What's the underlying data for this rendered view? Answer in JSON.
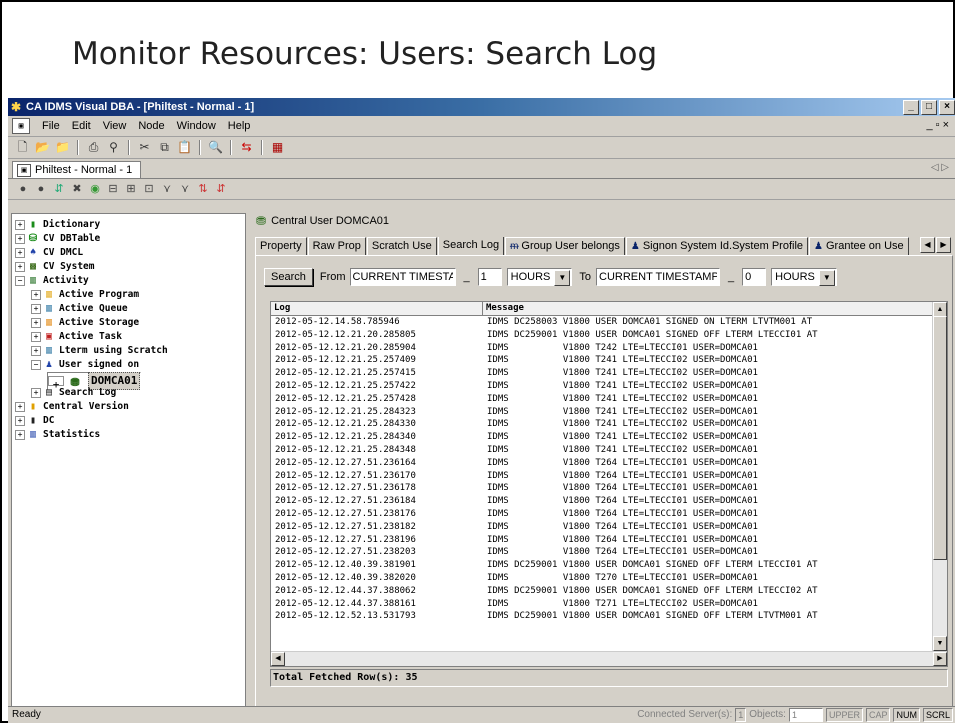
{
  "slide": {
    "title": "Monitor Resources: Users: Search Log"
  },
  "window": {
    "title": "CA IDMS Visual DBA - [Philtest - Normal - 1]",
    "controls": [
      "_",
      "□",
      "×"
    ]
  },
  "menu": {
    "items": [
      "File",
      "Edit",
      "View",
      "Node",
      "Window",
      "Help"
    ],
    "mdi_controls": "_ ▫ ×"
  },
  "doc_tab": {
    "label": "Philtest - Normal - 1",
    "arrows": "◁ ▷"
  },
  "tree": {
    "nodes": [
      {
        "label": "Dictionary",
        "icon": "dictionary-icon",
        "sign": "+"
      },
      {
        "label": "CV DBTable",
        "icon": "dbtable-icon",
        "sign": "+"
      },
      {
        "label": "CV DMCL",
        "icon": "dmcl-icon",
        "sign": "+"
      },
      {
        "label": "CV System",
        "icon": "system-icon",
        "sign": "+"
      },
      {
        "label": "Activity",
        "icon": "activity-icon",
        "sign": "−"
      },
      {
        "label": "Active Program",
        "icon": "program-icon",
        "sign": "+"
      },
      {
        "label": "Active Queue",
        "icon": "queue-icon",
        "sign": "+"
      },
      {
        "label": "Active Storage",
        "icon": "storage-icon",
        "sign": "+"
      },
      {
        "label": "Active Task",
        "icon": "task-icon",
        "sign": "+"
      },
      {
        "label": "Lterm using Scratch",
        "icon": "lterm-icon",
        "sign": "+"
      },
      {
        "label": "User signed on",
        "icon": "user-icon",
        "sign": "−"
      },
      {
        "label": "DOMCA01",
        "icon": "user-node-icon",
        "sign": "+"
      },
      {
        "label": "Search Log",
        "icon": "log-icon",
        "sign": "+"
      },
      {
        "label": "Central Version",
        "icon": "cv-icon",
        "sign": "+"
      },
      {
        "label": "DC",
        "icon": "dc-icon",
        "sign": "+"
      },
      {
        "label": "Statistics",
        "icon": "statistics-icon",
        "sign": "+"
      }
    ]
  },
  "panel": {
    "header": "Central User DOMCA01",
    "tabs": [
      {
        "label": "Property"
      },
      {
        "label": "Raw Prop"
      },
      {
        "label": "Scratch Use"
      },
      {
        "label": "Search Log"
      },
      {
        "label": "Group User belongs"
      },
      {
        "label": "Signon System Id.System Profile"
      },
      {
        "label": "Grantee on Use"
      }
    ],
    "search": {
      "button": "Search",
      "from_label": "From",
      "from_value": "CURRENT TIMESTAMP",
      "from_minus": "_",
      "from_qty": "1",
      "from_unit": "HOURS",
      "to_label": "To",
      "to_value": "CURRENT TIMESTAMP",
      "to_minus": "_",
      "to_qty": "0",
      "to_unit": "HOURS"
    },
    "grid": {
      "columns": [
        "Log",
        "Message"
      ],
      "rows": [
        [
          "2012-05-12.14.58.785946",
          "IDMS DC258003 V1800 USER DOMCA01 SIGNED ON LTERM LTVTM001 AT"
        ],
        [
          "2012-05-12.12.21.20.285805",
          "IDMS DC259001 V1800 USER DOMCA01 SIGNED OFF LTERM LTECCI01 AT"
        ],
        [
          "2012-05-12.12.21.20.285904",
          "IDMS          V1800 T242 LTE=LTECCI01 USER=DOMCA01"
        ],
        [
          "2012-05-12.12.21.25.257409",
          "IDMS          V1800 T241 LTE=LTECCI02 USER=DOMCA01"
        ],
        [
          "2012-05-12.12.21.25.257415",
          "IDMS          V1800 T241 LTE=LTECCI02 USER=DOMCA01"
        ],
        [
          "2012-05-12.12.21.25.257422",
          "IDMS          V1800 T241 LTE=LTECCI02 USER=DOMCA01"
        ],
        [
          "2012-05-12.12.21.25.257428",
          "IDMS          V1800 T241 LTE=LTECCI02 USER=DOMCA01"
        ],
        [
          "2012-05-12.12.21.25.284323",
          "IDMS          V1800 T241 LTE=LTECCI02 USER=DOMCA01"
        ],
        [
          "2012-05-12.12.21.25.284330",
          "IDMS          V1800 T241 LTE=LTECCI02 USER=DOMCA01"
        ],
        [
          "2012-05-12.12.21.25.284340",
          "IDMS          V1800 T241 LTE=LTECCI02 USER=DOMCA01"
        ],
        [
          "2012-05-12.12.21.25.284348",
          "IDMS          V1800 T241 LTE=LTECCI02 USER=DOMCA01"
        ],
        [
          "2012-05-12.12.27.51.236164",
          "IDMS          V1800 T264 LTE=LTECCI01 USER=DOMCA01"
        ],
        [
          "2012-05-12.12.27.51.236170",
          "IDMS          V1800 T264 LTE=LTECCI01 USER=DOMCA01"
        ],
        [
          "2012-05-12.12.27.51.236178",
          "IDMS          V1800 T264 LTE=LTECCI01 USER=DOMCA01"
        ],
        [
          "2012-05-12.12.27.51.236184",
          "IDMS          V1800 T264 LTE=LTECCI01 USER=DOMCA01"
        ],
        [
          "2012-05-12.12.27.51.238176",
          "IDMS          V1800 T264 LTE=LTECCI01 USER=DOMCA01"
        ],
        [
          "2012-05-12.12.27.51.238182",
          "IDMS          V1800 T264 LTE=LTECCI01 USER=DOMCA01"
        ],
        [
          "2012-05-12.12.27.51.238196",
          "IDMS          V1800 T264 LTE=LTECCI01 USER=DOMCA01"
        ],
        [
          "2012-05-12.12.27.51.238203",
          "IDMS          V1800 T264 LTE=LTECCI01 USER=DOMCA01"
        ],
        [
          "2012-05-12.12.40.39.381901",
          "IDMS DC259001 V1800 USER DOMCA01 SIGNED OFF LTERM LTECCI01 AT"
        ],
        [
          "2012-05-12.12.40.39.382020",
          "IDMS          V1800 T270 LTE=LTECCI01 USER=DOMCA01"
        ],
        [
          "2012-05-12.12.44.37.388062",
          "IDMS DC259001 V1800 USER DOMCA01 SIGNED OFF LTERM LTECCI02 AT"
        ],
        [
          "2012-05-12.12.44.37.388161",
          "IDMS          V1800 T271 LTE=LTECCI02 USER=DOMCA01"
        ],
        [
          "2012-05-12.12.52.13.531793",
          "IDMS DC259001 V1800 USER DOMCA01 SIGNED OFF LTERM LTVTM001 AT"
        ]
      ]
    },
    "total": "Total Fetched Row(s): 35"
  },
  "statusbar": {
    "left": "Ready",
    "connected_label": "Connected Server(s):",
    "connected_value": "1",
    "objects_label": "Objects:",
    "objects_value": "1",
    "indicators": [
      "UPPER",
      "CAP",
      "NUM",
      "SCRL"
    ]
  }
}
